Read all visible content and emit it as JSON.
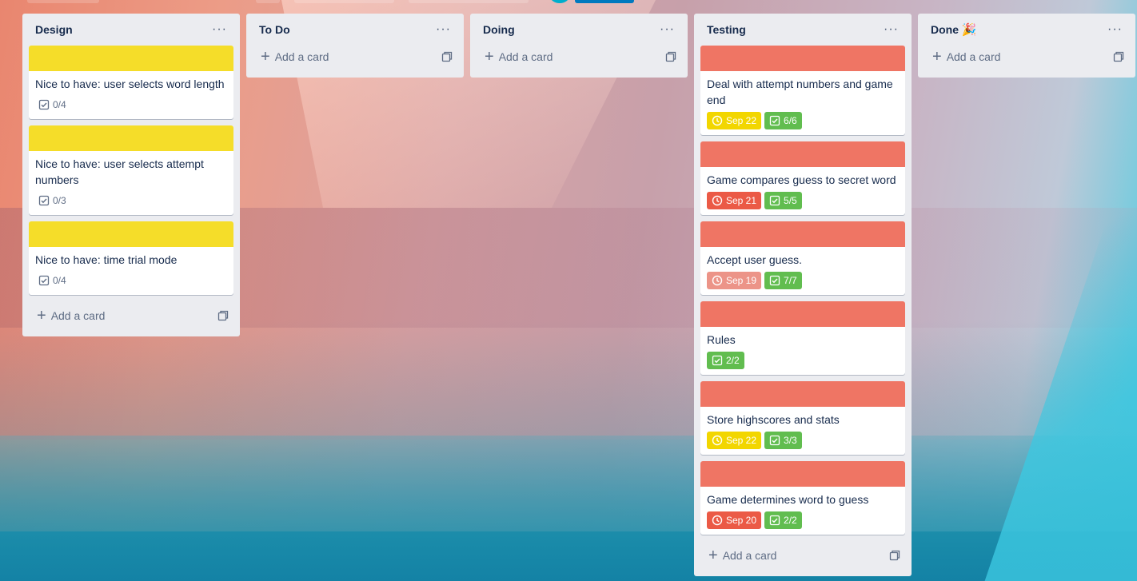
{
  "colors": {
    "list_bg": "#ebecf0",
    "label_yellow": "#f5dd29",
    "label_red": "#ef7564",
    "badge_green": "#61bd4f",
    "due_yellow": "#f2d600",
    "due_red": "#eb5a46",
    "due_pink": "#ec9488"
  },
  "icons": {
    "menu": "list-menu-icon",
    "checklist": "checklist-icon",
    "clock": "clock-icon",
    "plus": "plus-icon",
    "template": "card-template-icon"
  },
  "lists": [
    {
      "title": "Design",
      "add_card": "Add a card",
      "cards": [
        {
          "cover": "yellow",
          "title": "Nice to have: user selects word length",
          "checklist": "0/4"
        },
        {
          "cover": "yellow",
          "title": "Nice to have: user selects attempt numbers",
          "checklist": "0/3"
        },
        {
          "cover": "yellow",
          "title": "Nice to have: time trial mode",
          "checklist": "0/4"
        }
      ]
    },
    {
      "title": "To Do",
      "add_card": "Add a card",
      "cards": []
    },
    {
      "title": "Doing",
      "add_card": "Add a card",
      "cards": []
    },
    {
      "title": "Testing",
      "add_card": "Add a card",
      "cards": [
        {
          "cover": "red",
          "title": "Deal with attempt numbers and game end",
          "due": "Sep 22",
          "due_status": "yellow",
          "checklist": "6/6"
        },
        {
          "cover": "red",
          "title": "Game compares guess to secret word",
          "due": "Sep 21",
          "due_status": "red",
          "checklist": "5/5"
        },
        {
          "cover": "red",
          "title": "Accept user guess.",
          "due": "Sep 19",
          "due_status": "pink",
          "checklist": "7/7"
        },
        {
          "cover": "red",
          "title": "Rules",
          "checklist": "2/2"
        },
        {
          "cover": "red",
          "title": "Store highscores and stats",
          "due": "Sep 22",
          "due_status": "yellow",
          "checklist": "3/3"
        },
        {
          "cover": "red",
          "title": "Game determines word to guess",
          "due": "Sep 20",
          "due_status": "red",
          "checklist": "2/2"
        }
      ]
    },
    {
      "title": "Done",
      "title_emoji": "🎉",
      "add_card": "Add a card",
      "cards": []
    }
  ]
}
